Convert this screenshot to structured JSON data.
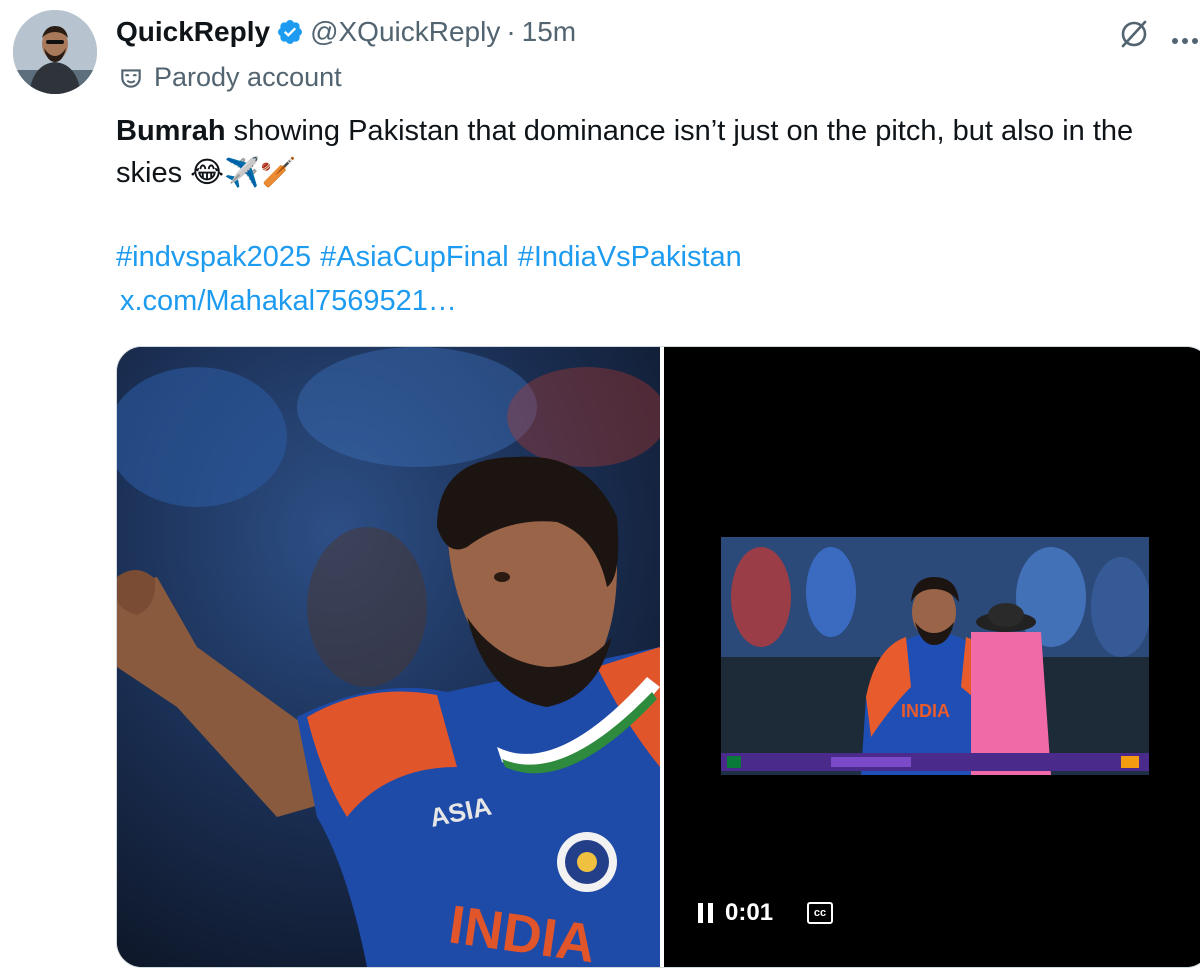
{
  "tweet": {
    "author_name": "QuickReply",
    "handle": "@XQuickReply",
    "separator": "·",
    "time": "15m",
    "parody_label": "Parody account",
    "text_bold": "Bumrah",
    "text_rest": " showing Pakistan that dominance isn’t just on the pitch, but also in the skies 😂✈️🏏",
    "hashtags": [
      "#indvspak2025",
      "#AsiaCupFinal",
      "#IndiaVsPakistan"
    ],
    "link": "x.com/Mahakal7569521…"
  },
  "icons": {
    "verified": "verified-badge-icon",
    "grok": "grok-icon",
    "more": "more-icon",
    "parody": "mask-icon",
    "pause": "pause-icon",
    "captions": "captions-icon"
  },
  "video": {
    "time": "0:01",
    "cc_label": "cc"
  },
  "colors": {
    "link": "#1d9bf0",
    "secondary_text": "#536471",
    "primary_text": "#0f1419",
    "verified": "#1d9bf0"
  }
}
